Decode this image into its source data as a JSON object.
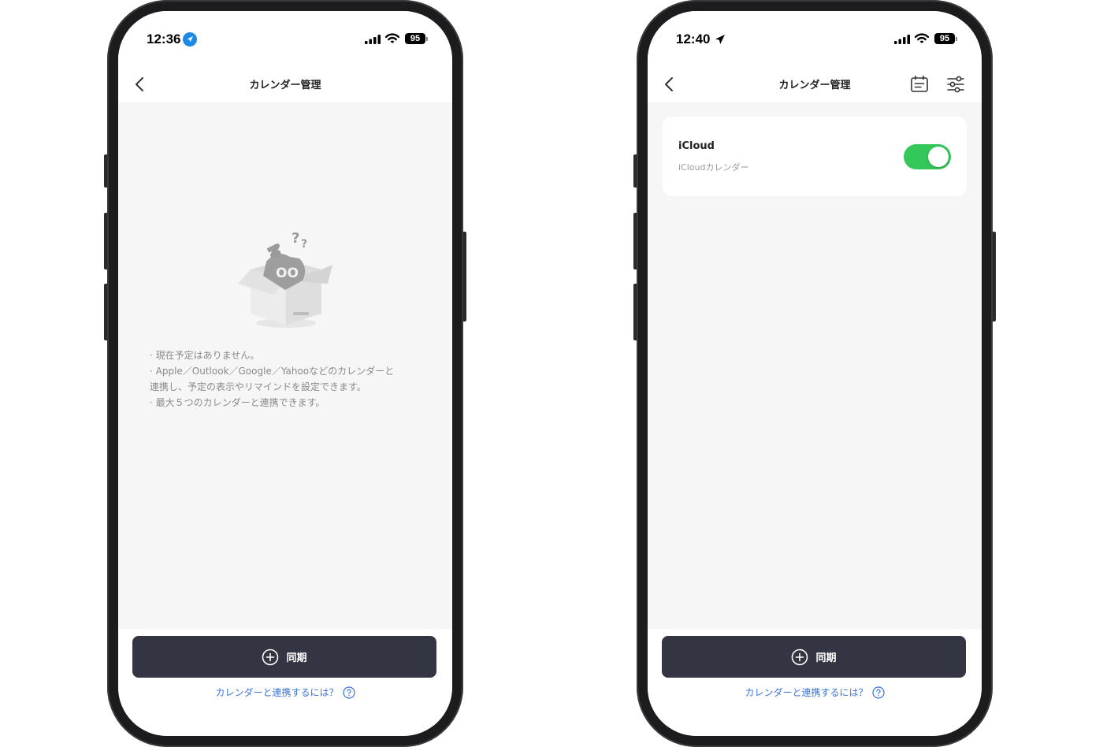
{
  "colors": {
    "accent_blue": "#3b74d6",
    "toggle_on": "#34c759",
    "sync_button": "#333642",
    "location_badge": "#1e88e5"
  },
  "left_screen": {
    "status": {
      "time": "12:36",
      "battery": "95",
      "location_icon": "location-arrow-badge-icon"
    },
    "nav": {
      "title": "カレンダー管理",
      "back_icon": "chevron-left-icon"
    },
    "empty_state": {
      "illustration": "empty-box-icon",
      "illustration_text": "OO",
      "lines": [
        "· 現在予定はありません。",
        "· Apple／Outlook／Google／Yahooなどのカレンダーと\n連携し、予定の表示やリマインドを設定できます。",
        "· 最大５つのカレンダーと連携できます。"
      ]
    },
    "sync_button": {
      "label": "同期",
      "icon": "plus-circle-icon"
    },
    "help_link": {
      "text": "カレンダーと連携するには？",
      "icon": "question-circle-icon"
    }
  },
  "right_screen": {
    "status": {
      "time": "12:40",
      "battery": "95",
      "location_icon": "location-arrow-icon"
    },
    "nav": {
      "title": "カレンダー管理",
      "back_icon": "chevron-left-icon",
      "right_icons": [
        "calendar-list-icon",
        "sliders-icon"
      ]
    },
    "calendar_item": {
      "title": "iCloud",
      "subtitle": "iCloudカレンダー",
      "enabled": true
    },
    "sync_button": {
      "label": "同期",
      "icon": "plus-circle-icon"
    },
    "help_link": {
      "text": "カレンダーと連携するには？",
      "icon": "question-circle-icon"
    }
  }
}
